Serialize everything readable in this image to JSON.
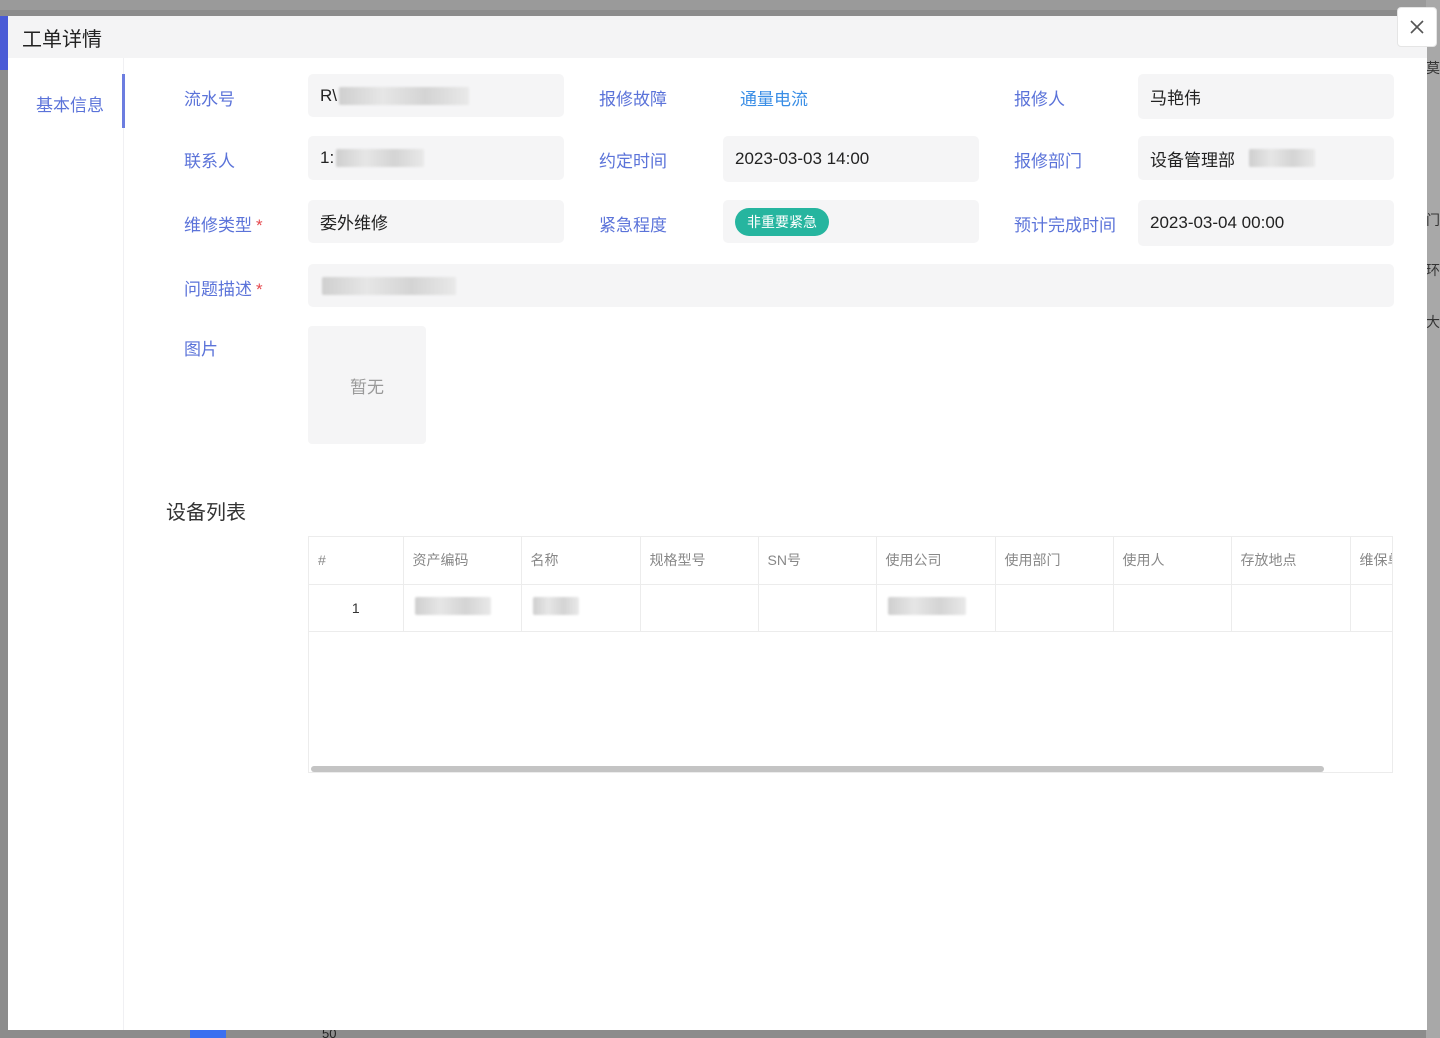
{
  "modal": {
    "title": "工单详情"
  },
  "side_nav": {
    "items": [
      {
        "label": "基本信息"
      }
    ]
  },
  "form": {
    "serial_no": {
      "label": "流水号",
      "value_prefix": "R\\"
    },
    "fault": {
      "label": "报修故障",
      "value": "通量电流"
    },
    "reporter": {
      "label": "报修人",
      "value": "马艳伟"
    },
    "contact": {
      "label": "联系人",
      "value_prefix": "1:"
    },
    "appointment_time": {
      "label": "约定时间",
      "value": "2023-03-03 14:00"
    },
    "department": {
      "label": "报修部门",
      "value_prefix": "设备管理部"
    },
    "repair_type": {
      "label": "维修类型",
      "required_mark": "*",
      "value": "委外维修"
    },
    "urgency": {
      "label": "紧急程度",
      "value": "非重要紧急"
    },
    "expected_finish": {
      "label": "预计完成时间",
      "value": "2023-03-04 00:00"
    },
    "description": {
      "label": "问题描述",
      "required_mark": "*"
    },
    "images": {
      "label": "图片",
      "empty_text": "暂无"
    }
  },
  "device_list": {
    "title": "设备列表",
    "columns": [
      "#",
      "资产编码",
      "名称",
      "规格型号",
      "SN号",
      "使用公司",
      "使用部门",
      "使用人",
      "存放地点",
      "维保单位"
    ],
    "rows": [
      {
        "index": "1"
      }
    ]
  },
  "colors": {
    "label": "#5b73d9",
    "link": "#3a8ee6",
    "urgency_tag": "#26b59f",
    "required": "#e5484d"
  },
  "background": {
    "right_edge_chars": [
      "莫",
      "门",
      "环",
      "大"
    ],
    "page_size": "50"
  }
}
